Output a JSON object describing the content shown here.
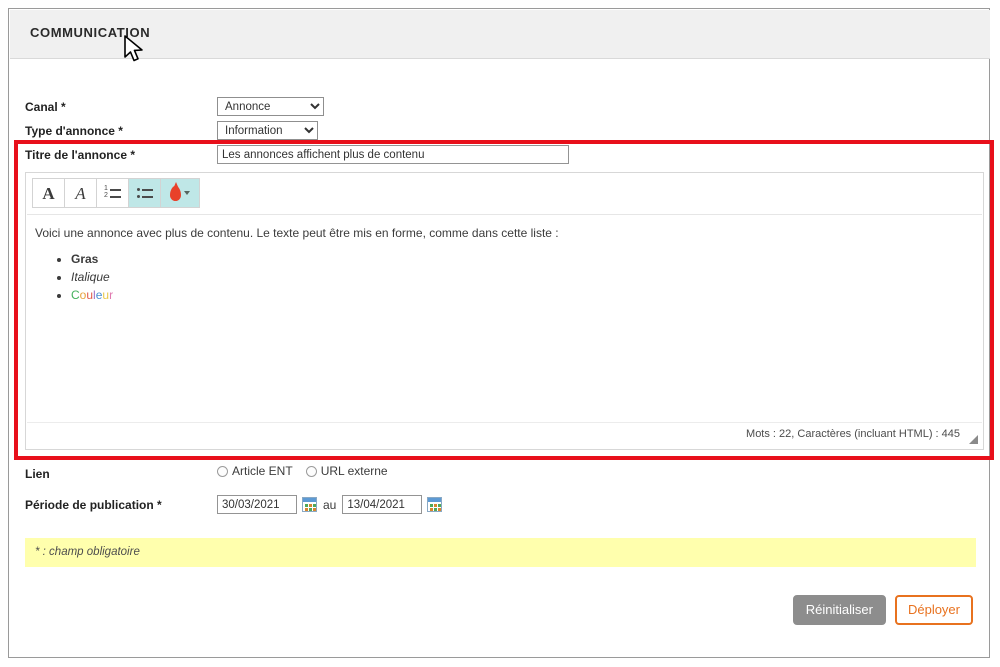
{
  "header": {
    "title": "COMMUNICATION"
  },
  "form": {
    "canal": {
      "label": "Canal *",
      "selected": "Annonce",
      "options": [
        "Annonce"
      ]
    },
    "type_annonce": {
      "label": "Type d'annonce *",
      "selected": "Information",
      "options": [
        "Information"
      ]
    },
    "titre": {
      "label": "Titre de l'annonce *",
      "value": "Les annonces affichent plus de contenu",
      "placeholder": ""
    },
    "lien": {
      "label": "Lien",
      "options": [
        {
          "label": "Article ENT",
          "selected": false
        },
        {
          "label": "URL externe",
          "selected": false
        }
      ]
    },
    "periode": {
      "label": "Période de publication *",
      "start": "30/03/2021",
      "separator": "au",
      "end": "13/04/2021",
      "calendar_icon": "calendar-icon"
    }
  },
  "editor": {
    "toolbar": [
      {
        "name": "bold-button",
        "glyph": "A",
        "label": "Gras",
        "active": false
      },
      {
        "name": "italic-button",
        "glyph": "A",
        "label": "Italique",
        "active": false
      },
      {
        "name": "ordered-list-button",
        "glyph": "ordered-list-icon",
        "label": "Liste numérotée",
        "active": false
      },
      {
        "name": "unordered-list-button",
        "glyph": "bullet-list-icon",
        "label": "Liste à puces",
        "active": true
      },
      {
        "name": "text-color-button",
        "glyph": "color-droplet-icon",
        "label": "Couleur du texte",
        "active": true
      }
    ],
    "content": {
      "paragraph": "Voici une annonce avec plus de contenu. Le texte peut être mis en forme, comme dans cette liste :",
      "list": [
        {
          "text": "Gras",
          "style": "bold"
        },
        {
          "text": "Italique",
          "style": "italic"
        },
        {
          "text": "Couleur",
          "style": "color"
        }
      ]
    },
    "status": "Mots : 22, Caractères (incluant HTML) : 445",
    "resize_handle": "resize-grip-icon"
  },
  "notice": {
    "text": "* : champ obligatoire"
  },
  "actions": {
    "reset": "Réinitialiser",
    "deploy": "Déployer"
  },
  "highlight": {
    "color": "#e8101b"
  },
  "colors": {
    "header_bg": "#f0f0f0",
    "toolbar_active": "#bfe7e7",
    "droplet": "#e8412a",
    "notice_bg": "#ffffad",
    "reset_bg": "#8d8d8d",
    "deploy_accent": "#e8721f"
  }
}
